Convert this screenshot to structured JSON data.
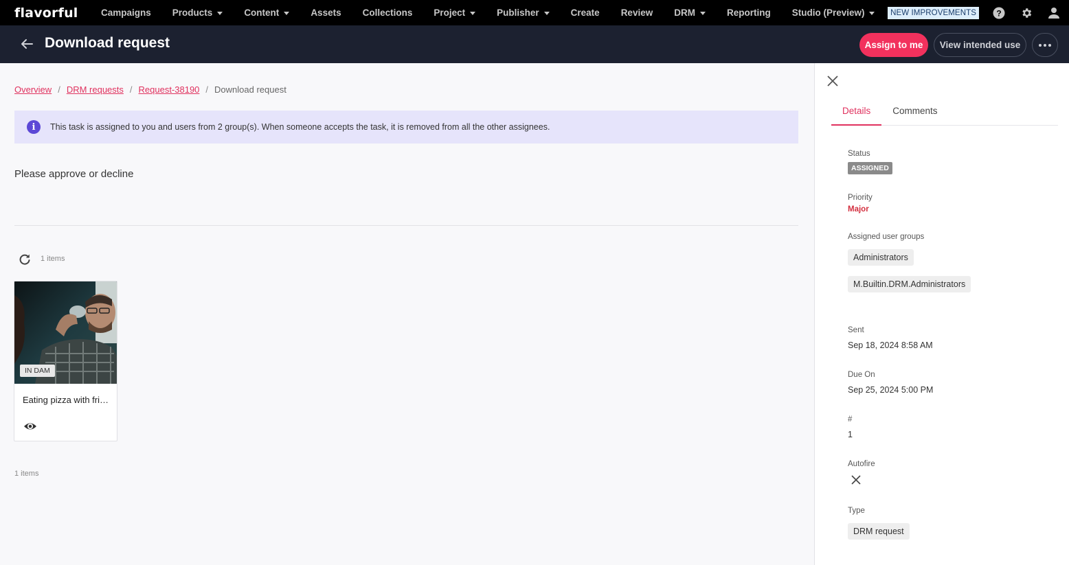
{
  "topnav": {
    "logo": "flavorful",
    "items": [
      {
        "label": "Campaigns",
        "dropdown": false
      },
      {
        "label": "Products",
        "dropdown": true
      },
      {
        "label": "Content",
        "dropdown": true
      },
      {
        "label": "Assets",
        "dropdown": false
      },
      {
        "label": "Collections",
        "dropdown": false
      },
      {
        "label": "Project",
        "dropdown": true
      },
      {
        "label": "Publisher",
        "dropdown": true
      },
      {
        "label": "Create",
        "dropdown": false
      },
      {
        "label": "Review",
        "dropdown": false
      },
      {
        "label": "DRM",
        "dropdown": true
      },
      {
        "label": "Reporting",
        "dropdown": false
      },
      {
        "label": "Studio (Preview)",
        "dropdown": true
      }
    ],
    "new_improvements": "NEW IMPROVEMENTS",
    "icons": [
      "help-icon",
      "gear-icon",
      "user-icon"
    ]
  },
  "header": {
    "title": "Download request",
    "assign_label": "Assign to me",
    "view_label": "View intended use",
    "accent": "#f2315d"
  },
  "breadcrumb": [
    {
      "label": "Overview",
      "link": true
    },
    {
      "label": "DRM requests",
      "link": true
    },
    {
      "label": "Request-38190",
      "link": true
    },
    {
      "label": "Download request",
      "link": false
    }
  ],
  "info_banner": "This task is assigned to you and users from 2 group(s). When someone accepts the task, it is removed from all the other assignees.",
  "prompt": "Please approve or decline",
  "items_count_top": "1 items",
  "items_count_bottom": "1 items",
  "assets": [
    {
      "badge": "IN DAM",
      "title": "Eating pizza with friends"
    }
  ],
  "panel": {
    "tabs": [
      {
        "label": "Details",
        "active": true
      },
      {
        "label": "Comments",
        "active": false
      }
    ],
    "status_label": "Status",
    "status_value": "ASSIGNED",
    "priority_label": "Priority",
    "priority_value": "Major",
    "groups_label": "Assigned user groups",
    "groups": [
      "Administrators",
      "M.Builtin.DRM.Administrators"
    ],
    "sent_label": "Sent",
    "sent_value": "Sep 18, 2024 8:58 AM",
    "due_label": "Due On",
    "due_value": "Sep 25, 2024 5:00 PM",
    "number_label": "#",
    "number_value": "1",
    "autofire_label": "Autofire",
    "autofire_value": false,
    "type_label": "Type",
    "type_value": "DRM request"
  }
}
